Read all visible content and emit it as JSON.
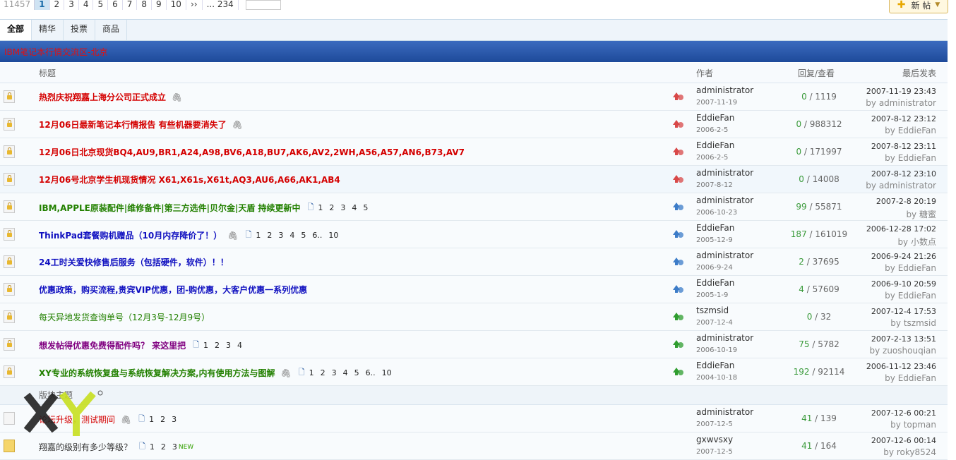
{
  "pager": {
    "total": "11457",
    "pages": [
      "1",
      "2",
      "3",
      "4",
      "5",
      "6",
      "7",
      "8",
      "9",
      "10"
    ],
    "next": "››",
    "last": "... 234"
  },
  "new_post": {
    "label": "新 帖"
  },
  "tabs": [
    "全部",
    "精华",
    "投票",
    "商品"
  ],
  "forum_title": "IBM笔记本行情交流区-北京",
  "columns": {
    "title": "标题",
    "author": "作者",
    "stats": "回复/查看",
    "last": "最后发表"
  },
  "threads": [
    {
      "title": "热烈庆祝翔嘉上海分公司正式成立",
      "color": "red",
      "bold": true,
      "attach": true,
      "pages": [],
      "icon": "red",
      "author": "administrator",
      "date": "2007-11-19",
      "replies": "0",
      "views": "1119",
      "last_time": "2007-11-19 23:43",
      "last_by": "administrator"
    },
    {
      "title": "12月06日最新笔记本行情报告  有些机器要消失了",
      "color": "red",
      "bold": true,
      "attach": true,
      "pages": [],
      "icon": "red",
      "author": "EddieFan",
      "date": "2006-2-5",
      "replies": "0",
      "views": "988312",
      "last_time": "2007-8-12 23:12",
      "last_by": "EddieFan"
    },
    {
      "title": "12月06日北京现货BQ4,AU9,BR1,A24,A98,BV6,A18,BU7,AK6,AV2,2WH,A56,A57,AN6,B73,AV7",
      "color": "red",
      "bold": true,
      "attach": false,
      "pages": [],
      "icon": "red",
      "author": "EddieFan",
      "date": "2006-2-5",
      "replies": "0",
      "views": "171997",
      "last_time": "2007-8-12 23:11",
      "last_by": "EddieFan"
    },
    {
      "title": "12月06号北京学生机现货情况  X61,X61s,X61t,AQ3,AU6,A66,AK1,AB4",
      "color": "red",
      "bold": true,
      "attach": false,
      "pages": [],
      "icon": "red",
      "author": "administrator",
      "date": "2007-8-12",
      "replies": "0",
      "views": "14008",
      "last_time": "2007-8-12 23:10",
      "last_by": "administrator"
    },
    {
      "title": "IBM,APPLE原装配件|维修备件|第三方选件|贝尔金|天盾  持续更新中",
      "color": "green",
      "bold": true,
      "attach": false,
      "pages": [
        "1",
        "2",
        "3",
        "4",
        "5"
      ],
      "icon": "blue",
      "author": "administrator",
      "date": "2006-10-23",
      "replies": "99",
      "views": "55871",
      "last_time": "2007-2-8 20:19",
      "last_by": "糖蜜"
    },
    {
      "title": "ThinkPad套餐购机赠品（10月内存降价了！）",
      "color": "blue",
      "bold": true,
      "attach": true,
      "pages": [
        "1",
        "2",
        "3",
        "4",
        "5",
        "6..",
        "10"
      ],
      "icon": "blue",
      "author": "EddieFan",
      "date": "2005-12-9",
      "replies": "187",
      "views": "161019",
      "last_time": "2006-12-28 17:02",
      "last_by": "小数点"
    },
    {
      "title": "24工时关爱快修售后服务（包括硬件，软件）！！",
      "color": "blue",
      "bold": true,
      "attach": false,
      "pages": [],
      "icon": "blue",
      "author": "administrator",
      "date": "2006-9-24",
      "replies": "2",
      "views": "37695",
      "last_time": "2006-9-24 21:26",
      "last_by": "EddieFan"
    },
    {
      "title": "优惠政策，购买流程,贵宾VIP优惠，团-购优惠，大客户优惠一系列优惠",
      "color": "blue",
      "bold": true,
      "attach": false,
      "pages": [],
      "icon": "blue",
      "author": "EddieFan",
      "date": "2005-1-9",
      "replies": "4",
      "views": "57609",
      "last_time": "2006-9-10 20:59",
      "last_by": "EddieFan"
    },
    {
      "title": "每天异地发货查询单号（12月3号-12月9号）",
      "color": "green",
      "bold": false,
      "attach": false,
      "pages": [],
      "icon": "green",
      "author": "tszmsid",
      "date": "2007-12-4",
      "replies": "0",
      "views": "32",
      "last_time": "2007-12-4 17:53",
      "last_by": "tszmsid"
    },
    {
      "title": "想发帖得优惠免费得配件吗？  来这里把",
      "color": "purple",
      "bold": true,
      "attach": false,
      "pages": [
        "1",
        "2",
        "3",
        "4"
      ],
      "icon": "green",
      "author": "administrator",
      "date": "2006-10-19",
      "replies": "75",
      "views": "5782",
      "last_time": "2007-2-13 13:51",
      "last_by": "zuoshouqian"
    },
    {
      "title": "XY专业的系统恢复盘与系统恢复解决方案,内有使用方法与图解",
      "color": "green",
      "bold": true,
      "attach": true,
      "pages": [
        "1",
        "2",
        "3",
        "4",
        "5",
        "6..",
        "10"
      ],
      "icon": "green",
      "author": "EddieFan",
      "date": "2004-10-18",
      "replies": "192",
      "views": "92114",
      "last_time": "2006-11-12 23:46",
      "last_by": "EddieFan"
    }
  ],
  "section_label": "版块主题",
  "topics": [
    {
      "title": "论坛升级，测试期间",
      "color": "red",
      "bold": false,
      "attach": true,
      "pages": [
        "1",
        "2",
        "3"
      ],
      "author": "administrator",
      "date": "2007-12-5",
      "replies": "41",
      "views": "139",
      "last_time": "2007-12-6 00:21",
      "last_by": "topman"
    },
    {
      "title": "翔嘉的级别有多少等级？",
      "color": "gray",
      "bold": false,
      "attach": false,
      "pages": [
        "1",
        "2",
        "3"
      ],
      "newtag": "NEW",
      "author": "gxwvsxy",
      "date": "2007-12-5",
      "replies": "41",
      "views": "164",
      "last_time": "2007-12-6 00:14",
      "last_by": "roky8524"
    }
  ]
}
